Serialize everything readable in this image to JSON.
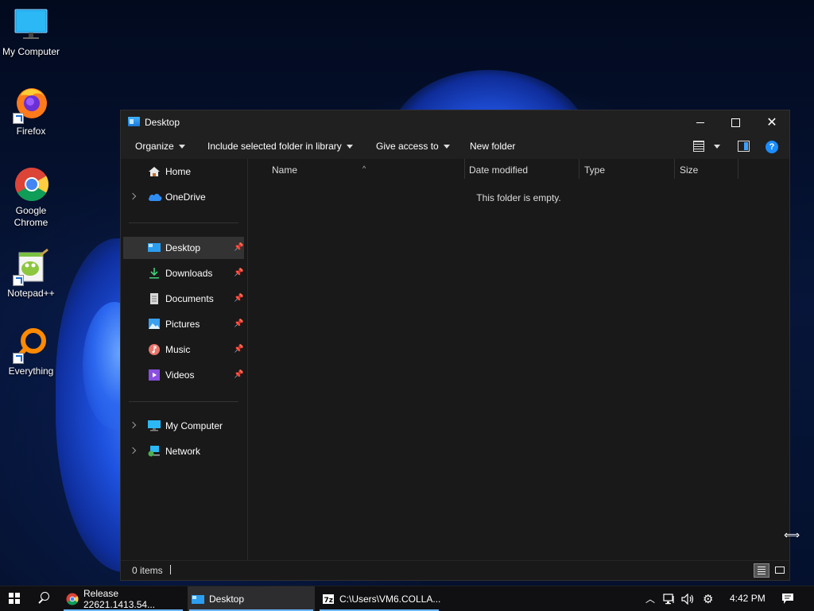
{
  "desktop": {
    "icons": [
      {
        "label": "My Computer"
      },
      {
        "label": "Firefox"
      },
      {
        "label": "Google Chrome"
      },
      {
        "label": "Notepad++"
      },
      {
        "label": "Everything"
      }
    ]
  },
  "window": {
    "title": "Desktop",
    "toolbar": {
      "organize": "Organize",
      "include_in_library": "Include selected folder in library",
      "give_access": "Give access to",
      "new_folder": "New folder",
      "help": "?"
    },
    "nav": {
      "top": [
        {
          "label": "Home",
          "icon": "home-icon"
        },
        {
          "label": "OneDrive",
          "icon": "onedrive-icon"
        }
      ],
      "quick_access": [
        {
          "label": "Desktop",
          "icon": "desktop-icon",
          "pinned": true,
          "selected": true
        },
        {
          "label": "Downloads",
          "icon": "download-icon",
          "pinned": true
        },
        {
          "label": "Documents",
          "icon": "documents-icon",
          "pinned": true
        },
        {
          "label": "Pictures",
          "icon": "pictures-icon",
          "pinned": true
        },
        {
          "label": "Music",
          "icon": "music-icon",
          "pinned": true
        },
        {
          "label": "Videos",
          "icon": "videos-icon",
          "pinned": true
        }
      ],
      "bottom": [
        {
          "label": "My Computer",
          "icon": "computer-icon"
        },
        {
          "label": "Network",
          "icon": "network-icon"
        }
      ]
    },
    "columns": {
      "name": "Name",
      "date_modified": "Date modified",
      "type": "Type",
      "size": "Size"
    },
    "empty_message": "This folder is empty.",
    "status": {
      "items": "0 items"
    }
  },
  "taskbar": {
    "apps": [
      {
        "label": "Release 22621.1413.54...",
        "icon": "chrome-icon"
      },
      {
        "label": "Desktop",
        "icon": "explorer-icon",
        "active": true
      },
      {
        "label": "C:\\Users\\VM6.COLLA...",
        "icon": "7zip-icon"
      }
    ],
    "clock": "4:42 PM"
  },
  "colors": {
    "window_bg": "#191919",
    "titlebar_bg": "#202020",
    "accent": "#1a8cff",
    "taskbar_bg": "#101012"
  }
}
